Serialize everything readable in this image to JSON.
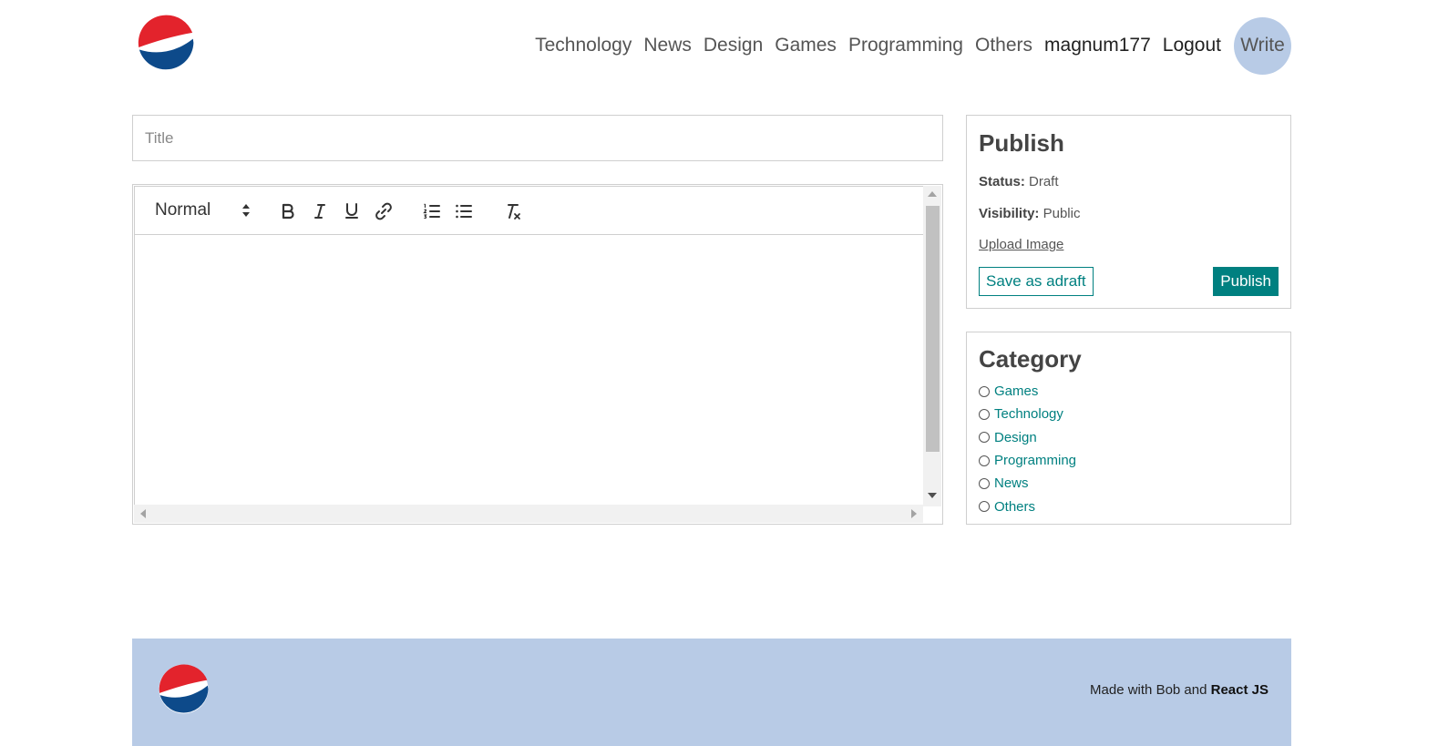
{
  "brand": {
    "logo_icon": "pepsi-logo-icon",
    "colors": {
      "red": "#e3232c",
      "blue": "#0d4a8a",
      "accent": "#008080",
      "nav_highlight": "#b8cbe6"
    }
  },
  "nav": {
    "links": [
      "Technology",
      "News",
      "Design",
      "Games",
      "Programming",
      "Others"
    ],
    "username": "magnum177",
    "logout": "Logout",
    "write": "Write"
  },
  "editor": {
    "title_placeholder": "Title",
    "header_select": "Normal",
    "tools": [
      "bold-icon",
      "italic-icon",
      "underline-icon",
      "link-icon",
      "ordered-list-icon",
      "bullet-list-icon",
      "clear-format-icon"
    ]
  },
  "publish": {
    "heading": "Publish",
    "status_label": "Status:",
    "status_value": "Draft",
    "visibility_label": "Visibility:",
    "visibility_value": "Public",
    "upload": "Upload Image",
    "draft_button": "Save as adraft",
    "publish_button": "Publish"
  },
  "category": {
    "heading": "Category",
    "items": [
      "Games",
      "Technology",
      "Design",
      "Programming",
      "News",
      "Others"
    ]
  },
  "footer": {
    "prefix": "Made with Bob and",
    "bold": "React JS"
  }
}
